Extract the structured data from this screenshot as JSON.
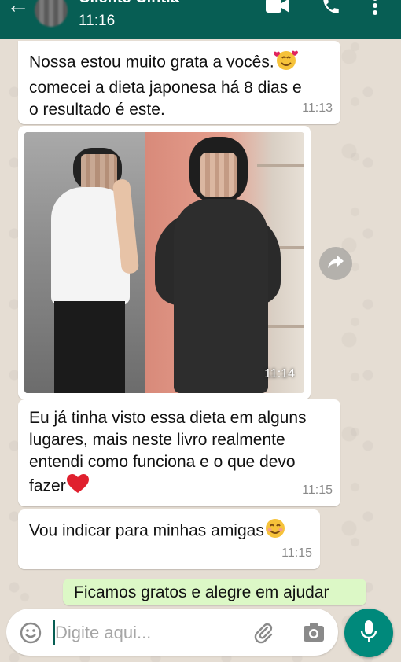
{
  "header": {
    "contact_name": "Cliente Cintia",
    "status_time": "11:16",
    "colors": {
      "bar": "#075e54"
    }
  },
  "messages": [
    {
      "id": "m1",
      "type": "text",
      "text_lines": [
        "Nossa estou muito grata a vocês.",
        "comecei a dieta japonesa há 8 dias e",
        "o resultado é este."
      ],
      "emoji": "smiling-face-with-hearts",
      "time": "11:13"
    },
    {
      "id": "m2",
      "type": "image",
      "time": "11:14"
    },
    {
      "id": "m3",
      "type": "text",
      "text_lines": [
        "Eu já tinha visto essa dieta em alguns",
        "lugares, mais neste livro realmente",
        "entendi como funciona e o que devo",
        "fazer"
      ],
      "emoji": "red-heart",
      "time": "11:15"
    },
    {
      "id": "m4",
      "type": "text",
      "text_lines": [
        "Vou indicar para minhas amigas"
      ],
      "emoji": "smiling-face-with-smiling-eyes",
      "time": "11:15"
    },
    {
      "id": "m5",
      "type": "outgoing",
      "text_lines": [
        "Ficamos gratos e alegre em ajudar"
      ]
    }
  ],
  "composer": {
    "placeholder": "Digite aqui..."
  }
}
